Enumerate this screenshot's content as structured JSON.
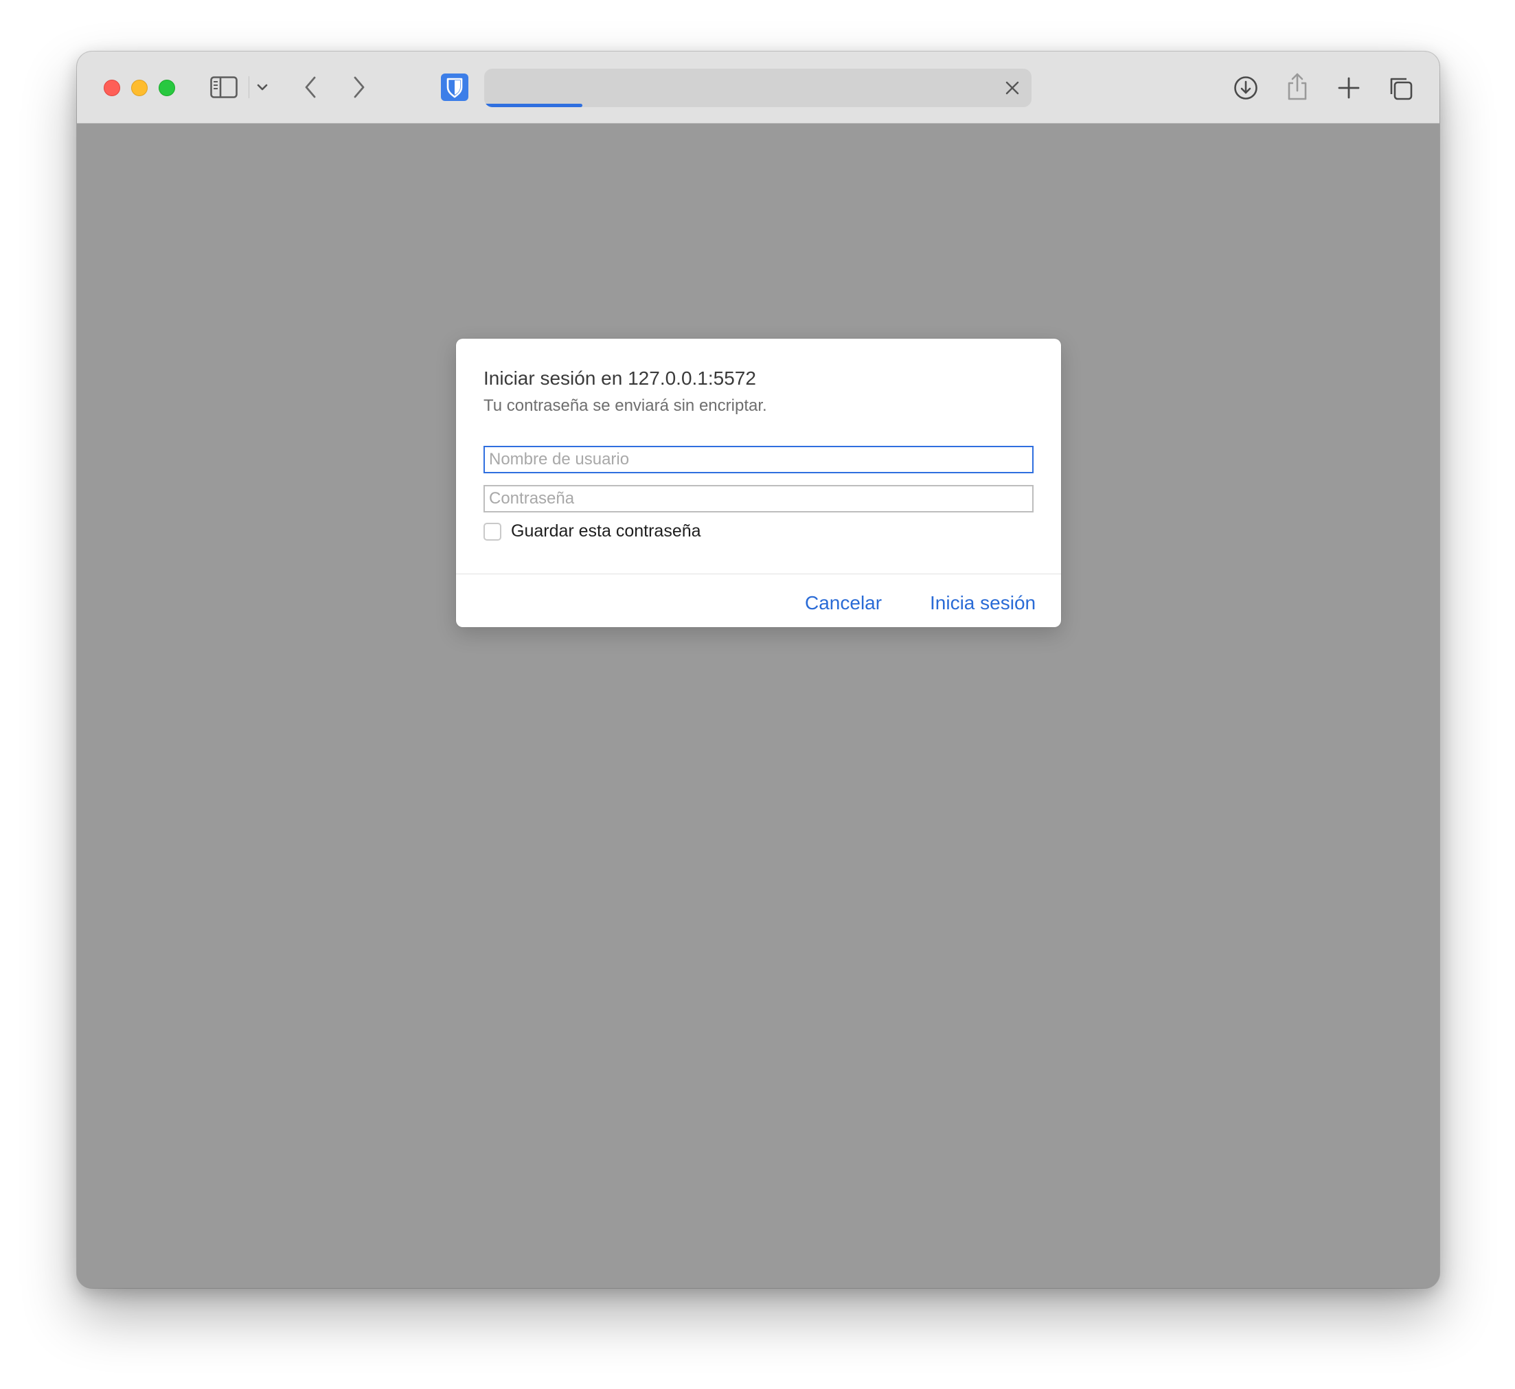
{
  "toolbar": {
    "icons": {
      "close": "close-window-button",
      "minimize": "minimize-window-button",
      "maximize": "maximize-window-button",
      "sidebar": "sidebar-icon",
      "sidebar_menu": "chevron-down-icon",
      "back": "chevron-left-icon",
      "forward": "chevron-right-icon",
      "extension": "bitwarden-shield-icon",
      "clear": "close-icon",
      "downloads": "download-icon",
      "share": "share-icon",
      "new_tab": "plus-icon",
      "tab_overview": "tabs-icon"
    },
    "address": {
      "value": "",
      "progress_fraction": 0.18
    }
  },
  "dialog": {
    "title": "Iniciar sesión en 127.0.0.1:5572",
    "subtitle": "Tu contraseña se enviará sin encriptar.",
    "username_placeholder": "Nombre de usuario",
    "username_value": "",
    "password_placeholder": "Contraseña",
    "password_value": "",
    "remember_label": "Guardar esta contraseña",
    "remember_checked": false,
    "cancel_label": "Cancelar",
    "login_label": "Inicia sesión"
  },
  "colors": {
    "accent": "#2a6bd6",
    "content_background": "#9a9a9a",
    "toolbar_background": "#e1e1e1",
    "extension_icon": "#3c7ee8"
  }
}
